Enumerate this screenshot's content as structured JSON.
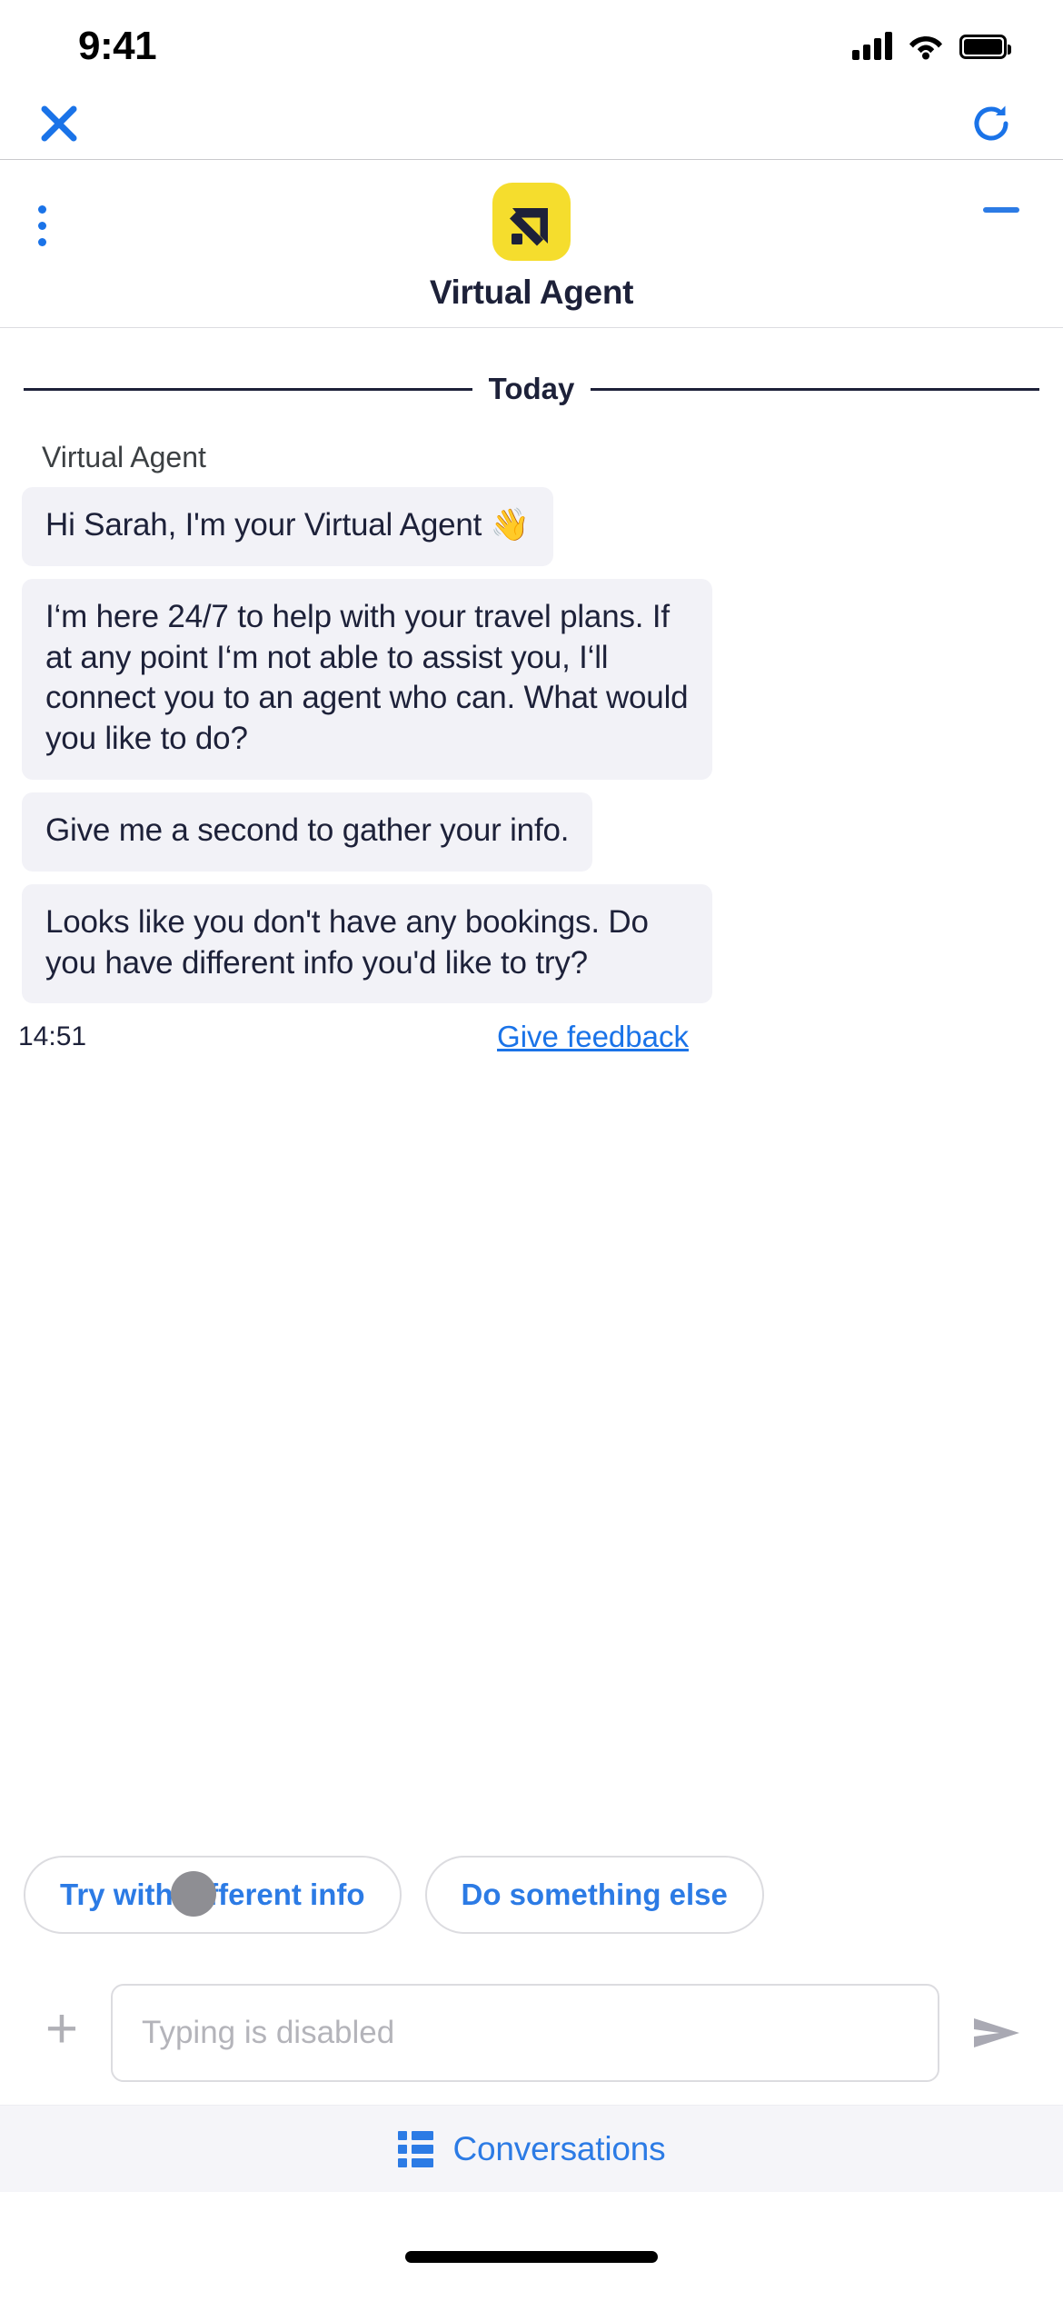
{
  "status_bar": {
    "time": "9:41",
    "signal_icon": "signal-bars-icon",
    "wifi_icon": "wifi-icon",
    "battery_icon": "battery-full-icon"
  },
  "browser_bar": {
    "close_icon": "close-x-icon",
    "close_label": "✕",
    "reload_icon": "reload-icon",
    "accent_color": "#1a73e8"
  },
  "agent_header": {
    "menu_icon": "kebab-menu-icon",
    "minimize_icon": "minimize-icon",
    "logo_icon": "arrow-up-right-logo-icon",
    "logo_bg_color": "#f5dd2d",
    "logo_fg_color": "#1d2139",
    "title": "Virtual Agent"
  },
  "chat": {
    "day_divider_label": "Today",
    "sender_name": "Virtual Agent",
    "messages": [
      {
        "text": "Hi Sarah, I'm your Virtual Agent 👋"
      },
      {
        "text": "I‘m here 24/7 to help with your travel plans. If at any point I‘m not able to assist you, I‘ll connect you to an agent who can. What would you like to do?"
      },
      {
        "text": "Give me a second to gather your info."
      },
      {
        "text": "Looks like you don't have any bookings. Do you have different info you'd like to try?"
      }
    ],
    "timestamp": "14:51",
    "feedback_link": "Give feedback",
    "bubble_bg_color": "#f2f2f7",
    "text_color": "#1d2139"
  },
  "quick_replies": {
    "chips": [
      {
        "label": "Try with different info"
      },
      {
        "label": "Do something else"
      }
    ],
    "touch_indicator": "touch-pointer-dot",
    "chip_text_color": "#2c7be5"
  },
  "input_bar": {
    "attach_icon": "plus-icon",
    "input_value": "",
    "input_placeholder": "Typing is disabled",
    "send_icon": "send-arrow-icon"
  },
  "footer": {
    "tab_icon": "conversations-list-icon",
    "tab_label": "Conversations",
    "tab_bg_color": "#f5f5f9",
    "tab_text_color": "#2c7be5"
  },
  "home_indicator": {
    "icon": "home-indicator-bar"
  }
}
